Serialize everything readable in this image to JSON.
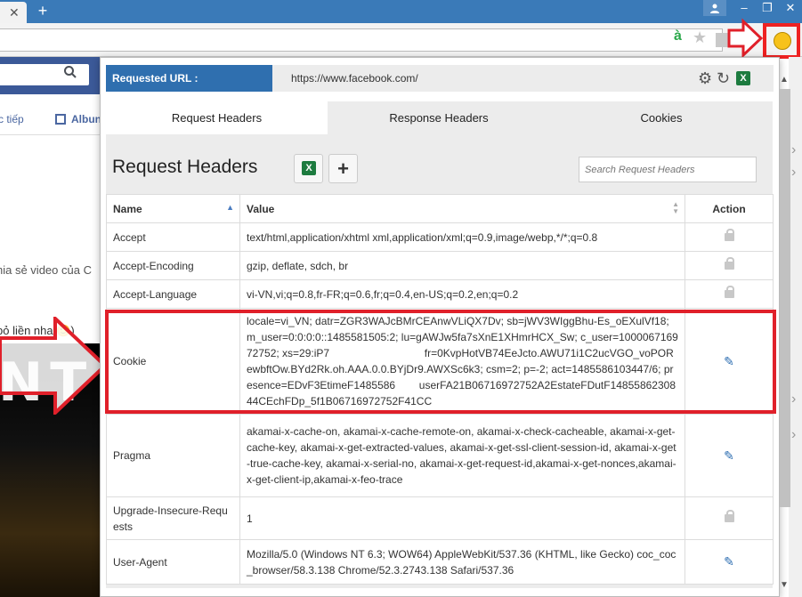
{
  "browser": {
    "tab_close": "✕",
    "new_tab": "+",
    "user_icon": "person-icon",
    "window_controls": [
      "–",
      "❐",
      "✕"
    ],
    "ext_letter": "à"
  },
  "background_page": {
    "subnav_text": "rc tiếp",
    "subnav_album": "Albun",
    "line1": "hia sẻ video của C",
    "line2": "bỏ liền nha 🙂)",
    "video_text": "NT S"
  },
  "popup": {
    "requested_url_label": "Requested URL :",
    "requested_url": "https://www.facebook.com/",
    "tabs": [
      {
        "label": "Request Headers",
        "active": true
      },
      {
        "label": "Response Headers",
        "active": false
      },
      {
        "label": "Cookies",
        "active": false
      }
    ],
    "title": "Request Headers",
    "add_button": "+",
    "search_placeholder": "Search Request Headers",
    "columns": {
      "name": "Name",
      "value": "Value",
      "action": "Action"
    },
    "rows": [
      {
        "name": "Accept",
        "value": "text/html,application/xhtml xml,application/xml;q=0.9,image/webp,*/*;q=0.8",
        "action": "lock"
      },
      {
        "name": "Accept-Encoding",
        "value": "gzip, deflate, sdch, br",
        "action": "lock"
      },
      {
        "name": "Accept-Language",
        "value": "vi-VN,vi;q=0.8,fr-FR;q=0.6,fr;q=0.4,en-US;q=0.2,en;q=0.2",
        "action": "lock"
      },
      {
        "name": "Cookie",
        "value": "locale=vi_VN; datr=ZGR3WAJcBMrCEAnwVLiQX7Dv; sb=jWV3WIggBhu-Es_oEXulVf18; m_user=0:0:0:0::1485581505:2; lu=gAWJw5fa7sXnE1XHmrHCX_Sw; c_user=100006716972752; xs=29:iP7                                fr=0KvpHotVB74EeJcto.AWU71i1C2ucVGO_voPORewbftOw.BYd2Rk.oh.AAA.0.0.BYjDr9.AWXSc6k3; csm=2; p=-2; act=1485586103447/6; presence=EDvF3EtimeF1485586        userFA21B06716972752A2EstateFDutF1485586230844CEchFDp_5f1B06716972752F41CC",
        "action": "edit"
      },
      {
        "name": "Pragma",
        "value": "akamai-x-cache-on, akamai-x-cache-remote-on, akamai-x-check-cacheable, akamai-x-get-cache-key, akamai-x-get-extracted-values, akamai-x-get-ssl-client-session-id, akamai-x-get-true-cache-key, akamai-x-serial-no, akamai-x-get-request-id,akamai-x-get-nonces,akamai-x-get-client-ip,akamai-x-feo-trace",
        "action": "edit"
      },
      {
        "name": "Upgrade-Insecure-Requests",
        "value": "1",
        "action": "lock"
      },
      {
        "name": "User-Agent",
        "value": "Mozilla/5.0 (Windows NT 6.3; WOW64) AppleWebKit/537.36 (KHTML, like Gecko) coc_coc_browser/58.3.138 Chrome/52.3.2743.138 Safari/537.36",
        "action": "edit"
      }
    ]
  },
  "colors": {
    "accent": "#2f6faf",
    "highlight": "#e0202a",
    "tabbar": "#3a7ab8"
  }
}
